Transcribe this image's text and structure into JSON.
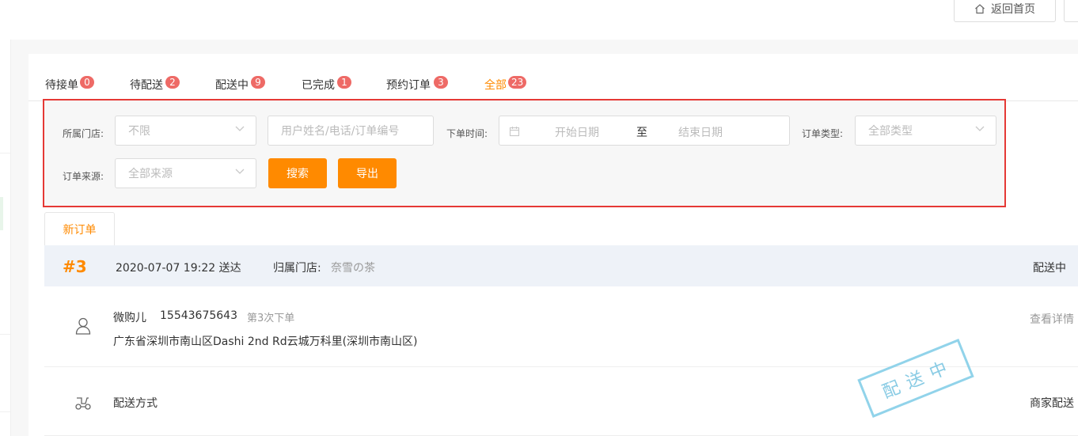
{
  "header": {
    "home_button": "返回首页"
  },
  "tabs": [
    {
      "label": "待接单",
      "count": "0"
    },
    {
      "label": "待配送",
      "count": "2"
    },
    {
      "label": "配送中",
      "count": "9"
    },
    {
      "label": "已完成",
      "count": "1"
    },
    {
      "label": "预约订单",
      "count": "3"
    },
    {
      "label": "全部",
      "count": "23",
      "active": true
    }
  ],
  "filters": {
    "store_label": "所属门店:",
    "store_value": "不限",
    "search_placeholder": "用户姓名/电话/订单编号",
    "time_label": "下单时间:",
    "start_placeholder": "开始日期",
    "range_sep": "至",
    "end_placeholder": "结束日期",
    "type_label": "订单类型:",
    "type_value": "全部类型",
    "source_label": "订单来源:",
    "source_value": "全部来源",
    "search_button": "搜索",
    "export_button": "导出"
  },
  "sub_tab": "新订单",
  "order": {
    "number": "#3",
    "time": "2020-07-07 19:22 送达",
    "store_label": "归属门店:",
    "store_name": "奈雪の茶",
    "status": "配送中",
    "customer_name": "微购儿",
    "phone": "15543675643",
    "order_count": "第3次下单",
    "address": "广东省深圳市南山区Dashi 2nd Rd云城万科里(深圳市南山区)",
    "detail_link": "查看详情",
    "delivery_label": "配送方式",
    "delivery_value": "商家配送",
    "stamp": "配送中"
  },
  "colors": {
    "accent": "#ff8a00",
    "badge": "#ee6a66",
    "highlight_border": "#e53935",
    "stamp": "#7cc6e2"
  }
}
